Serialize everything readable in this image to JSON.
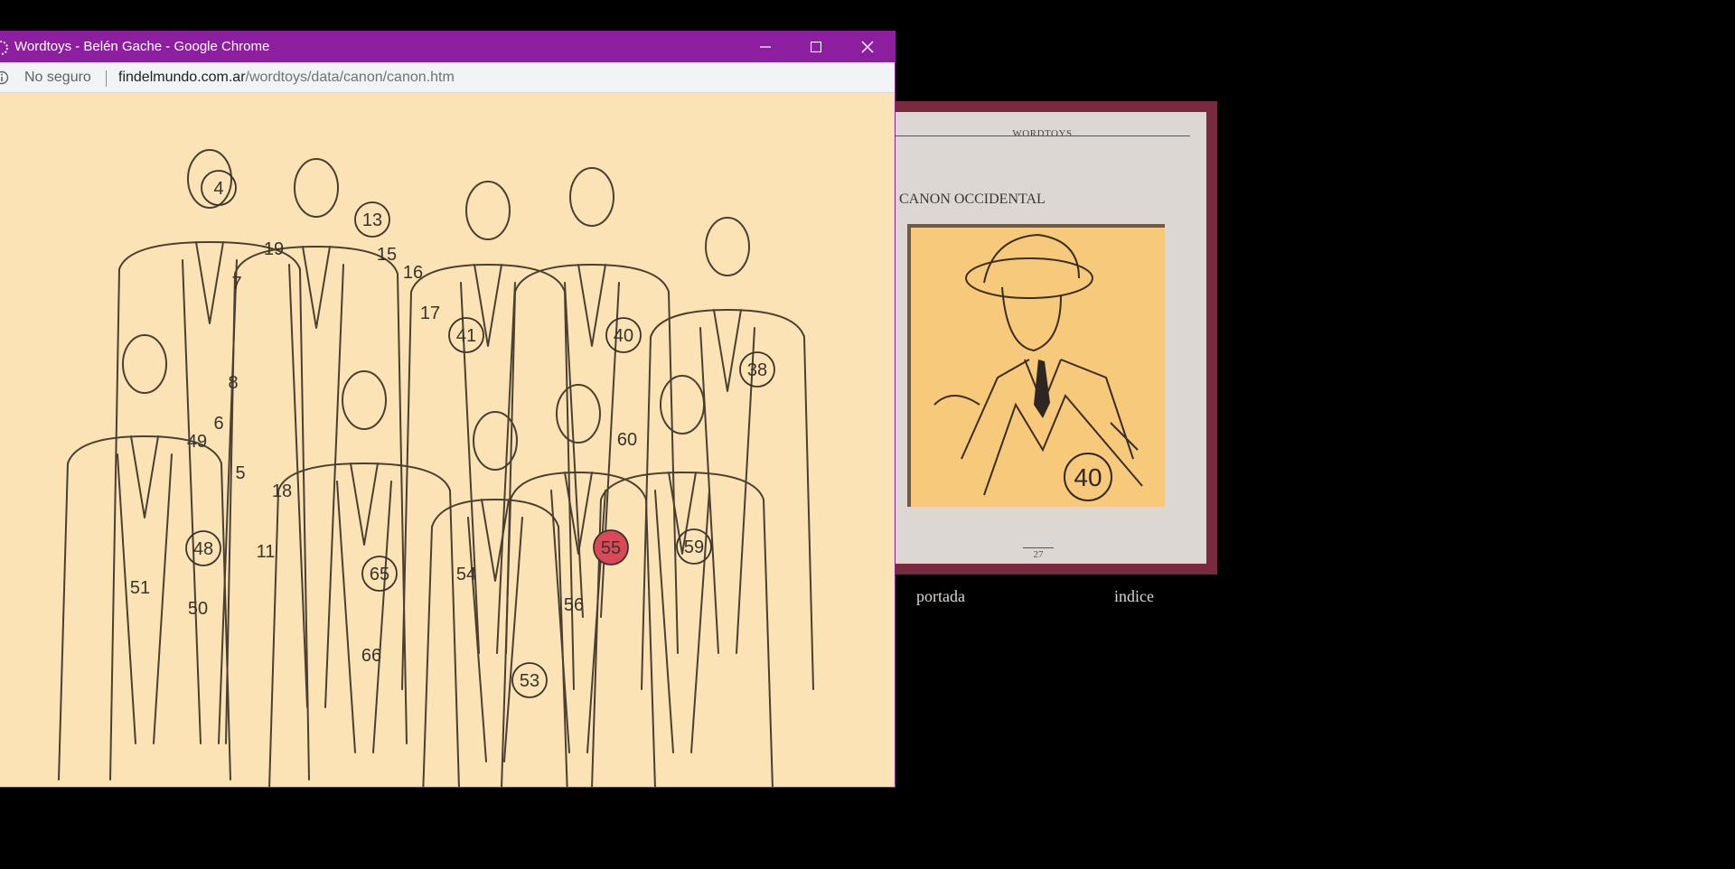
{
  "window": {
    "title": "Wordtoys - Belén Gache - Google Chrome",
    "title_bar_color": "#8e1ea0",
    "buttons": [
      "minimize-icon",
      "maximize-icon",
      "close-icon"
    ]
  },
  "address_bar": {
    "security_label": "No seguro",
    "url_host": "findelmundo.com.ar",
    "url_path": "/wordtoys/data/canon/canon.htm"
  },
  "illustration": {
    "background_color": "#fbe3b6",
    "highlight_color": "#d9495a",
    "highlighted_number": "55",
    "labels": [
      "4",
      "7",
      "8",
      "6",
      "5",
      "19",
      "18",
      "13",
      "15",
      "16",
      "17",
      "41",
      "40",
      "38",
      "60",
      "49",
      "48",
      "11",
      "51",
      "50",
      "65",
      "66",
      "54",
      "53",
      "56",
      "55",
      "59"
    ]
  },
  "book": {
    "header": "WORDTOYS",
    "title": "CANON OCCIDENTAL",
    "image_label": "40",
    "page_number": "27",
    "frame_color": "#7a2a3e",
    "nav": {
      "prev": "portada",
      "next": "indice"
    }
  }
}
